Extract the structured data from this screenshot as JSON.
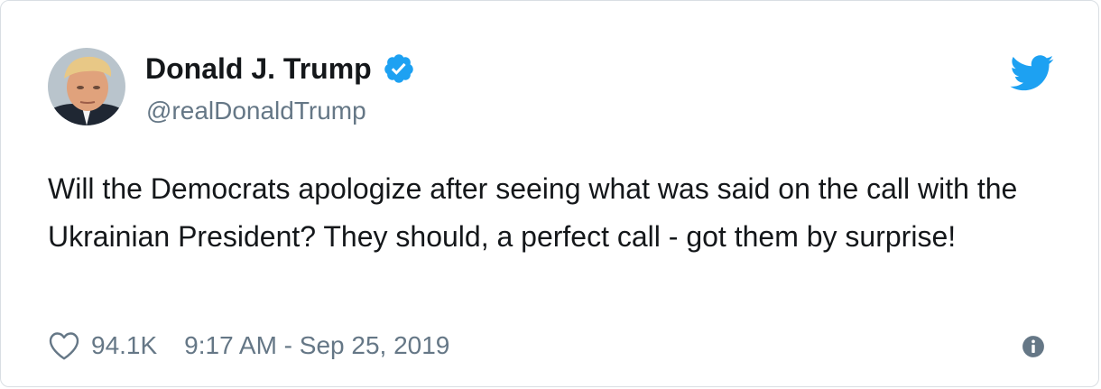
{
  "tweet": {
    "author": {
      "name": "Donald J. Trump",
      "handle": "@realDonaldTrump",
      "verified": true
    },
    "text": "Will the Democrats apologize after seeing what was said on the call with the Ukrainian President? They should, a perfect call - got them by surprise!",
    "likes": "94.1K",
    "timestamp": "9:17 AM - Sep 25, 2019"
  },
  "icons": {
    "brand": "twitter-bird-icon",
    "verified": "verified-badge-icon",
    "like": "heart-icon",
    "info": "info-icon"
  },
  "colors": {
    "twitter_blue": "#1da1f2",
    "text": "#14171a",
    "secondary_text": "#657786",
    "border": "#d9dee3"
  }
}
